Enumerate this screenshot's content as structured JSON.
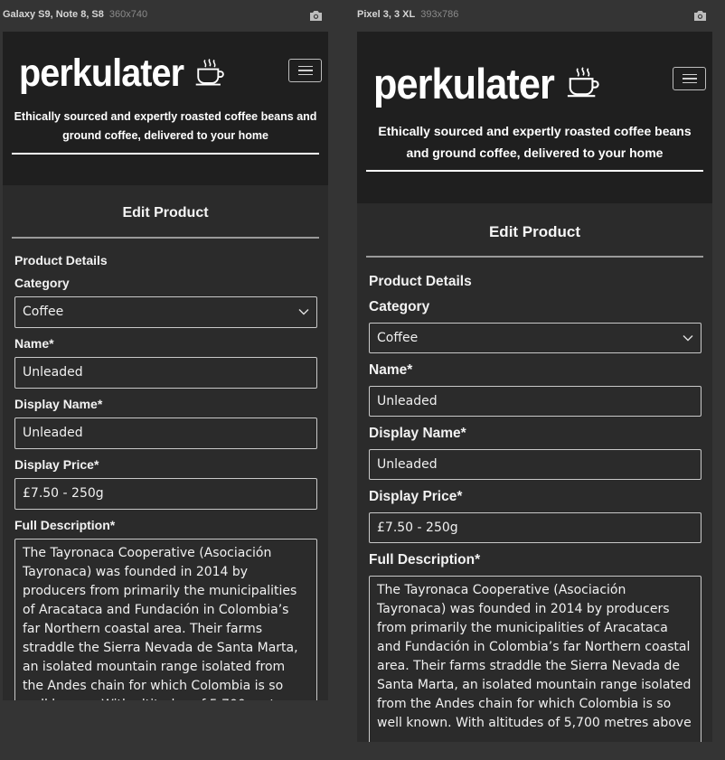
{
  "devices": [
    {
      "name": "Galaxy S9, Note 8, S8",
      "size": "360x740"
    },
    {
      "name": "Pixel 3, 3 XL",
      "size": "393x786"
    }
  ],
  "icons": {
    "screenshot": "camera-icon",
    "menu": "hamburger-icon",
    "logo_cup": "coffee-cup-icon",
    "select": "chevron-down-icon"
  },
  "colors": {
    "page_bg": "#343434",
    "header_bg": "#1f1f1f",
    "content_bg": "#2b2b2b",
    "text": "#ffffff"
  },
  "brand": {
    "logo": "perkulater"
  },
  "header": {
    "tagline": "Ethically sourced and expertly roasted coffee beans and ground coffee, delivered to your home"
  },
  "page": {
    "title": "Edit Product"
  },
  "form": {
    "section_title": "Product Details",
    "category": {
      "label": "Category",
      "value": "Coffee"
    },
    "name": {
      "label": "Name*",
      "value": "Unleaded"
    },
    "display_name": {
      "label": "Display Name*",
      "value": "Unleaded"
    },
    "display_price": {
      "label": "Display Price*",
      "value": "£7.50 - 250g"
    },
    "full_description": {
      "label": "Full Description*",
      "value": "The Tayronaca Cooperative (Asociación Tayronaca) was founded in 2014 by producers from primarily the municipalities of Aracataca and Fundación in Colombia’s far Northern coastal area. Their farms straddle the Sierra Nevada de Santa Marta, an isolated mountain range isolated from the Andes chain for which Colombia is so well known. With altitudes of 5,700 metres above"
    }
  }
}
